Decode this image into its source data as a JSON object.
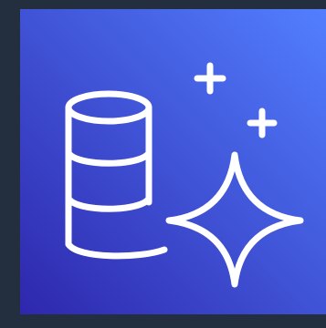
{
  "icon": {
    "name": "database-sparkle-icon",
    "glyphs": [
      "database-icon",
      "sparkle-icon",
      "plus-icon"
    ]
  },
  "colors": {
    "page_background": "#232F3E",
    "gradient_start": "#2E27AD",
    "gradient_end": "#527FFF",
    "stroke": "#FFFFFF"
  }
}
